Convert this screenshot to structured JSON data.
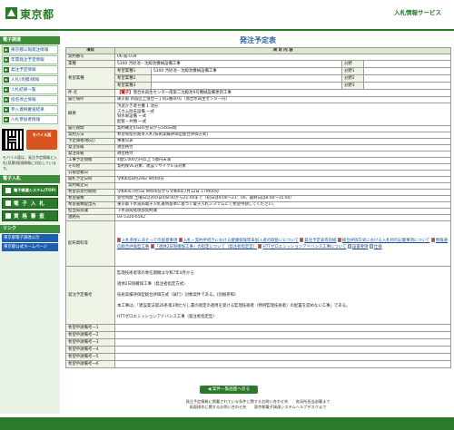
{
  "header": {
    "logo_text": "東京都",
    "service": "入札情報サービス"
  },
  "sidebar": {
    "section1": "電子調達",
    "items": [
      "東京都公報発注情報",
      "年間発注予定情報",
      "発注予定情報",
      "入札(見積)情報",
      "入札結果一覧",
      "指名停止情報",
      "参入資格審査結果",
      "入札参加者情報"
    ],
    "mobile_button": "モバイル版",
    "mobile_note": "モバイル版は、発注予定情報と入札(見積)経過情報に対応しています。",
    "section2": "電子入札",
    "big_buttons": [
      "電子調達システム(TOP)",
      "電 子 入 札",
      "資 格 審 査"
    ],
    "section3": "リンク",
    "links": [
      "東京都電子調達公示",
      "東京都公式ホームページ"
    ]
  },
  "main": {
    "title": "発注予定表",
    "col_item": "項目",
    "col_content": "項 目 内 容",
    "contract_no_label": "契約番号",
    "contract_no": "06-殺-039",
    "industry_label": "業種",
    "industry_value": "5300 汚砂池・沈殿池機械設備工事",
    "subdiv_label": "分野",
    "hope_label": "希望業種",
    "hope_rows": [
      {
        "label": "希望業種1",
        "value": "5300 汚砂池・沈殿池機械設備工事",
        "sub": "分野1"
      },
      {
        "label": "希望業種2",
        "value": "",
        "sub": "分野2"
      },
      {
        "label": "希望業種3",
        "value": "",
        "sub": "分野3"
      }
    ],
    "name_label": "件 名",
    "name_tag": "【電子】",
    "name_value": "落合水再生センター南第二沈殿池9号機械設備更新工事",
    "place_label": "履行場所",
    "place_value": "東京都 新宿区上落合一丁目2番40号（落合水再生センター内）",
    "overview_label": "概要",
    "overview_lines": [
      "汚泥かき寄せ機 1 池分",
      "スカム除去設備 一式",
      "制水扉設備 一式",
      "配管・弁類 一式"
    ],
    "period_label": "履行期間",
    "period_value": "契約確定の日の翌日から540日間",
    "method_label": "契約方法",
    "method_value": "希望制指名競争入札(技術実績評価型総合評価方式)",
    "price_label": "予定価格(税込)",
    "price_value": "事後公表",
    "dept_label": "発注等級",
    "dept_value": "規位格付",
    "grade_label": "発注等級",
    "grade_value": "規位格付",
    "scale_label": "工事予定規模",
    "scale_value": "4億5,000万円以上 5億円未満",
    "other_label": "その他",
    "other_value": "契約後VE対象、建設リサイクル法対象",
    "pub_label": "公報登載日",
    "pub_value": "",
    "open_label": "開札予定日時",
    "open_value": "令和6年8月29日 9時00分",
    "contract_date_label": "契約確定日",
    "contract_date_value": "",
    "announce_label": "希望票受付期間",
    "announce_value": "令和6年7月5日 9時00分から令和6年7月12日 17時00分",
    "receipt_label": "希望書類",
    "receipt_value": "受付時間 土曜日以外の日の8:00から21:00まで（初日は9:00〜21：00、最終日は8:00〜15:00）",
    "receive_place_label": "希望書類提出先",
    "receive_place_value": "東京都下水道局電子入札運用基準に基づく電子入札システムにて希望申請してください。",
    "dept2_label": "担当局部課",
    "dept2_value": "下水道局経理部契約課",
    "contact_label": "連絡先",
    "contact_value": "03-5320-6562",
    "docs_label": "配布資料等",
    "docs": [
      "入札参加にあたっての留意事項",
      "入札・契約手続きにおける健康保険等未加入者の取扱いについて",
      "発注予定表等別紙",
      "総合評価方式における入札時の記載事項について",
      "情報通信総合評価型工事",
      "「週休2日制確保工事」の指定について（発注者指定型）",
      "HTTゼロエミッションアドバンス工事について",
      "設置要領",
      "仕様"
    ],
    "remark_label": "発注予定備考",
    "remark_lines": [
      "監理技術者等の専任期間は令和7年4月から",
      "週休2日制確保工事（発注者指定方式）",
      "技術実績評価型総合評価方式（試行）対象案件である。(別紙参照)",
      "本工事は、「建設業法第26条第3項ただし書の規定の適用を受ける監理技術者（特例監理技術者）の配置を認めない工事」である。",
      "HTTゼロエミッションアドバンス工事（発注者指定型）"
    ],
    "hope_remark_rows": [
      "希望申請備考一1",
      "希望申請備考一2",
      "希望申請備考一3",
      "希望申請備考一4",
      "希望申請備考一5",
      "希望申請備考一6"
    ],
    "back_button": "◀ 案件一覧画面へ戻る"
  },
  "footer": {
    "line1": "発注予定情報に掲載されている条件に関するお問い合わせ先　　各局所担当部署まで",
    "line2": "画面操作に関するお問い合わせ先　　東京都電子調達システムヘルプデスクまで"
  },
  "colors": {
    "brand_green": "#2b7a2b",
    "header_blue": "#2b5f9e",
    "label_bg": "#eef5e6"
  }
}
